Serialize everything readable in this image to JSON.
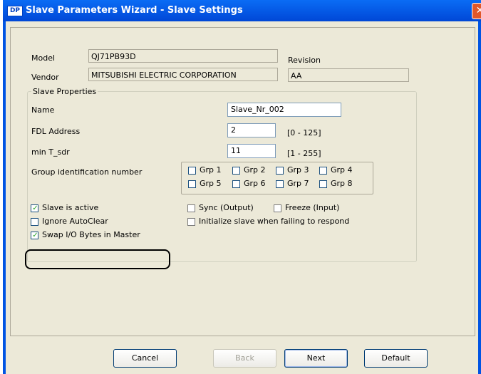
{
  "window": {
    "title": "Slave Parameters Wizard - Slave Settings",
    "icon_text": "DP",
    "close_glyph": "✕"
  },
  "model": {
    "label": "Model",
    "value": "QJ71PB93D"
  },
  "vendor": {
    "label": "Vendor",
    "value": "MITSUBISHI ELECTRIC CORPORATION"
  },
  "revision": {
    "label": "Revision",
    "value": "AA"
  },
  "slave_properties": {
    "title": "Slave Properties",
    "name": {
      "label": "Name",
      "value": "Slave_Nr_002"
    },
    "fdl": {
      "label": "FDL Address",
      "value": "2",
      "range": "[0 - 125]"
    },
    "tsdr": {
      "label": "min T_sdr",
      "value": "11",
      "range": "[1 - 255]"
    },
    "group": {
      "label": "Group identification number",
      "items": [
        "Grp 1",
        "Grp 2",
        "Grp 3",
        "Grp 4",
        "Grp 5",
        "Grp 6",
        "Grp 7",
        "Grp 8"
      ]
    },
    "options": {
      "slave_active": {
        "label": "Slave is active",
        "checked": true
      },
      "ignore_autoclear": {
        "label": "Ignore AutoClear",
        "checked": false
      },
      "swap_io": {
        "label": "Swap I/O Bytes in Master",
        "checked": true
      },
      "sync": {
        "label": "Sync (Output)",
        "checked": false
      },
      "freeze": {
        "label": "Freeze (Input)",
        "checked": false
      },
      "init_slave": {
        "label": "Initialize slave when failing to respond",
        "checked": false
      }
    }
  },
  "buttons": {
    "cancel": "Cancel",
    "back": "Back",
    "next": "Next",
    "default": "Default"
  }
}
